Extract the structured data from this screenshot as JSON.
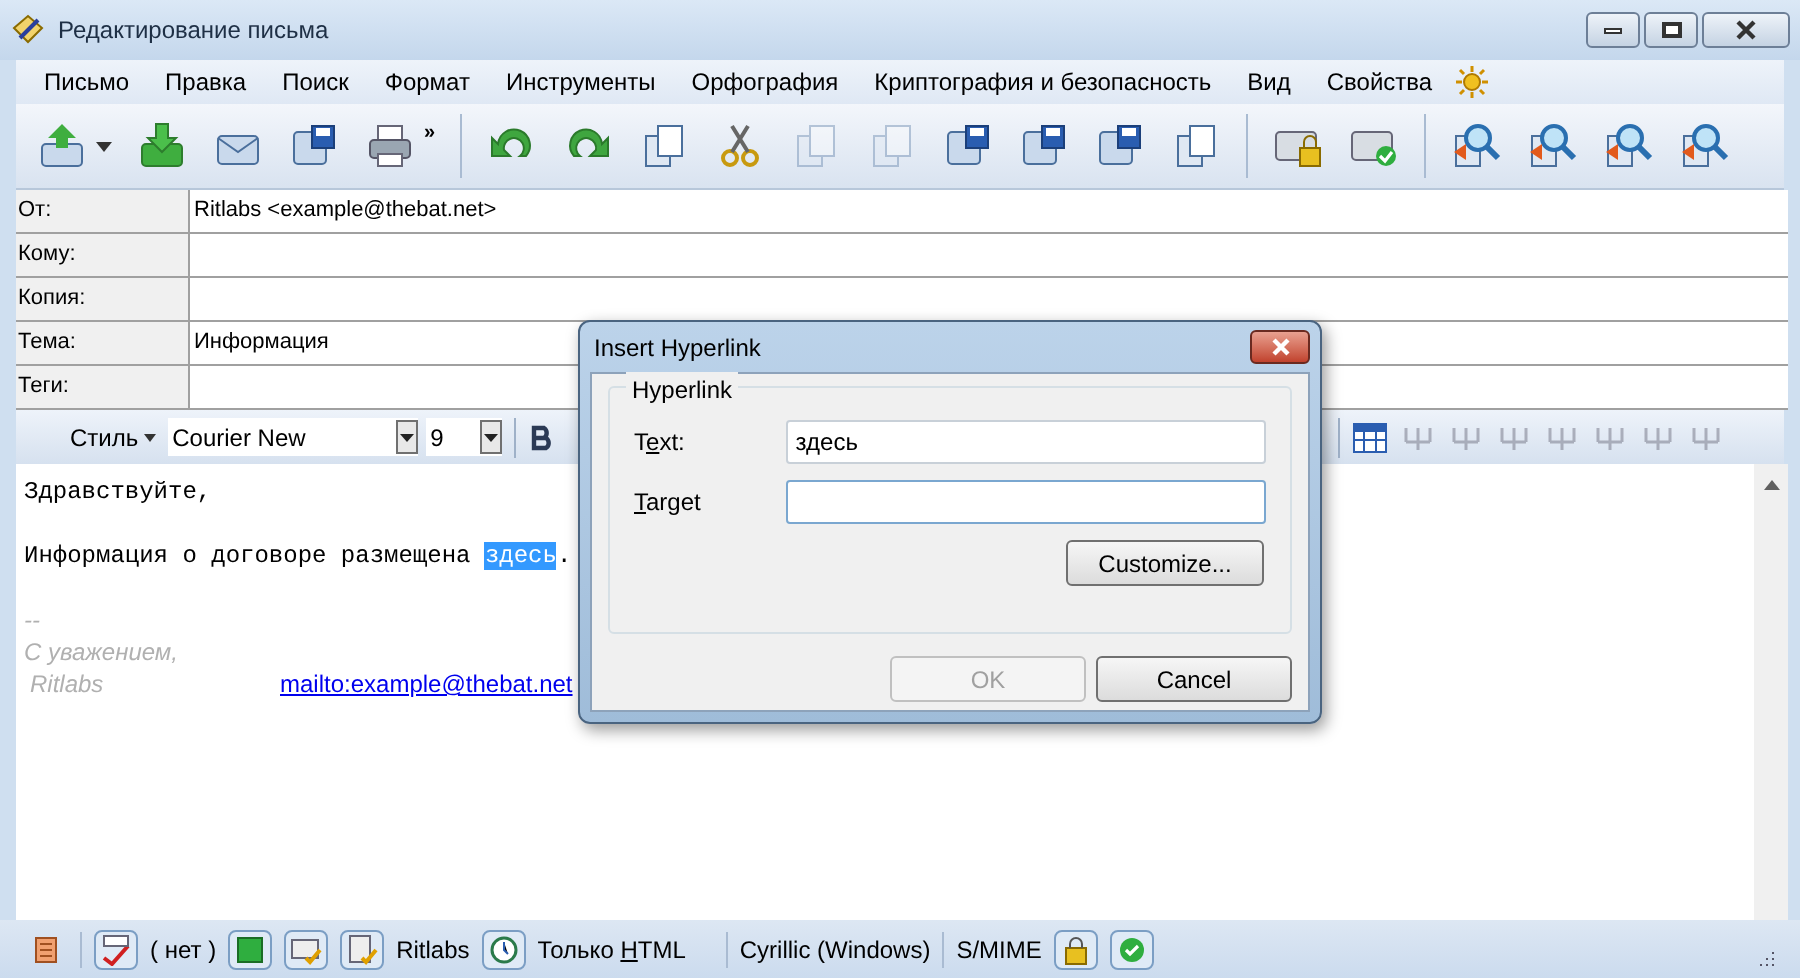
{
  "window": {
    "title": "Редактирование письма"
  },
  "menu": [
    "Письмо",
    "Правка",
    "Поиск",
    "Формат",
    "Инструменты",
    "Орфография",
    "Криптография и безопасность",
    "Вид",
    "Свойства"
  ],
  "header_fields": [
    {
      "label": "От:",
      "value": "Ritlabs <example@thebat.net>"
    },
    {
      "label": "Кому:"
    },
    {
      "label": "Копия:"
    },
    {
      "label": "Тема:",
      "value": "Информация"
    },
    {
      "label": "Теги:"
    }
  ],
  "toolbar": {
    "overflow": "»"
  },
  "format_toolbar": {
    "style_label": "Стиль",
    "font": "Courier New",
    "size": "9"
  },
  "body": {
    "greeting": "Здравствуйте,",
    "line_before": "Информация о договоре размещена ",
    "selected_word": "здесь",
    "line_after": ".",
    "signature_dash": "--",
    "signature_line": "С уважением,",
    "signature_name": "Ritlabs",
    "signature_link": "mailto:example@thebat.net"
  },
  "dialog": {
    "title": "Insert Hyperlink",
    "group": "Hyperlink",
    "fields": [
      {
        "label": [
          {
            "text": "T",
            "underlined": false
          },
          {
            "text": "e",
            "underlined": true
          },
          {
            "text": "xt:",
            "underlined": false
          }
        ],
        "value": "здесь"
      },
      {
        "label": [
          {
            "text": "T",
            "underlined": true
          },
          {
            "text": "arget",
            "underlined": false
          }
        ]
      }
    ],
    "customize": "Customize...",
    "ok": {
      "label": "OK",
      "disabled": true
    },
    "cancel": {
      "label": "Cancel",
      "disabled": false
    }
  },
  "status_bar": {
    "spell": "( нет )",
    "account": "Ritlabs",
    "format": {
      "label": [
        {
          "text": "Только ",
          "underlined": false
        },
        {
          "text": "H",
          "underlined": true
        },
        {
          "text": "TML",
          "underlined": false
        }
      ]
    },
    "charset": "Cyrillic (Windows)",
    "security": "S/MIME"
  }
}
